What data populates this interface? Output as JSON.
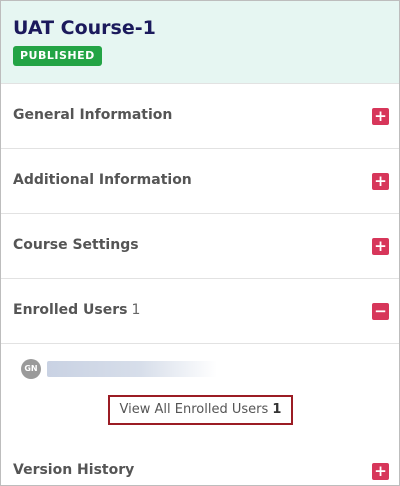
{
  "course": {
    "title": "UAT Course-1",
    "status": "PUBLISHED"
  },
  "sections": [
    {
      "label": "General Information",
      "expanded": false,
      "icon": "plus-icon"
    },
    {
      "label": "Additional Information",
      "expanded": false,
      "icon": "plus-icon"
    },
    {
      "label": "Course Settings",
      "expanded": false,
      "icon": "plus-icon"
    },
    {
      "label": "Enrolled Users",
      "count": "1",
      "expanded": true,
      "icon": "minus-icon"
    },
    {
      "label": "Version History",
      "expanded": false,
      "icon": "plus-icon"
    }
  ],
  "icons": {
    "plus": "+",
    "minus": "−"
  },
  "enrolled": {
    "users": [
      {
        "initials": "GN"
      }
    ],
    "view_all_label": "View All Enrolled Users",
    "view_all_count": "1"
  },
  "colors": {
    "header_bg": "#e6f6f2",
    "title": "#1b1a5c",
    "badge": "#23a445",
    "toggle": "#d7365a",
    "highlight_border": "#9b1c24"
  }
}
